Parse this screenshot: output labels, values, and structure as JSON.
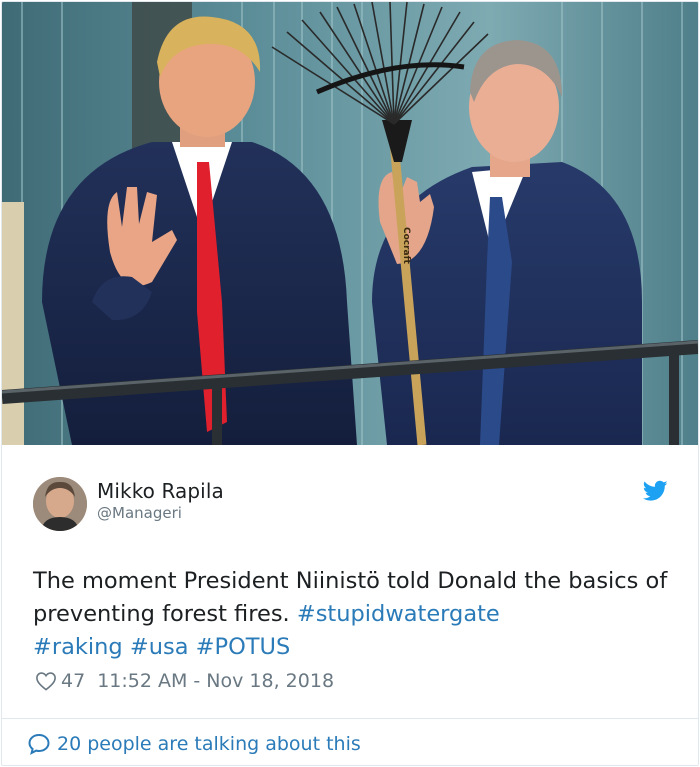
{
  "tweet": {
    "author": {
      "display_name": "Mikko Rapila",
      "handle": "@Manageri"
    },
    "text": {
      "plain": "The moment President Niinistö told Donald the basics of preventing forest fires. ",
      "hashtags": [
        "#stupidwatergate",
        "#raking",
        "#usa",
        "#POTUS"
      ]
    },
    "photo": {
      "rake_brand_text": "Cocraft"
    },
    "likes": "47",
    "timestamp": "11:52 AM - Nov 18, 2018",
    "talking_about": "20 people are talking about this"
  },
  "icons": {
    "brand": "twitter-bird-icon",
    "like": "heart-icon",
    "conversation": "speech-bubble-icon"
  },
  "colors": {
    "twitter_blue": "#1da1f2",
    "link_blue": "#2b7bb9",
    "meta_gray": "#697882",
    "text_dark": "#1c2022",
    "border": "#e1e8ed"
  }
}
